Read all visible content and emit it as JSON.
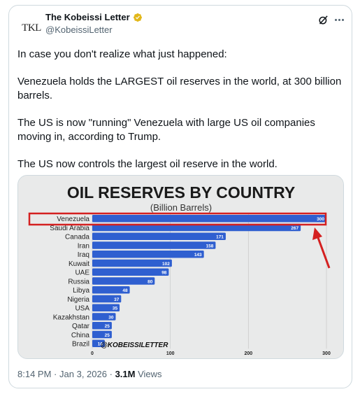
{
  "author": {
    "name": "The Kobeissi Letter",
    "handle": "@KobeissiLetter",
    "avatar_text": "TKL"
  },
  "tweet": {
    "paragraphs": [
      "In case you don't realize what just happened:",
      "Venezuela holds the LARGEST oil reserves in the world, at 300 billion barrels.",
      "The US is now \"running\" Venezuela with large US oil companies moving in, according to Trump.",
      "The US now controls the largest oil reserve in the world."
    ]
  },
  "meta": {
    "time": "8:14 PM",
    "date": "Jan 3, 2026",
    "views_count": "3.1M",
    "views_label": "Views",
    "separator": "·"
  },
  "icons": {
    "verified": "verified-badge-icon",
    "grok": "grok-icon",
    "more": "more-icon"
  },
  "colors": {
    "verified": "#e2b719",
    "bar": "#2f5fd0",
    "highlight": "#d42020",
    "chart_bg": "#e9eaea"
  },
  "chart_data": {
    "type": "bar",
    "orientation": "horizontal",
    "title": "OIL RESERVES BY COUNTRY",
    "subtitle": "(Billion Barrels)",
    "watermark": "@KOBEISSILETTER",
    "categories": [
      "Venezuela",
      "Saudi Arabia",
      "Canada",
      "Iran",
      "Iraq",
      "Kuwait",
      "UAE",
      "Russia",
      "Libya",
      "Nigeria",
      "USA",
      "Kazakhstan",
      "Qatar",
      "China",
      "Brazil"
    ],
    "values": [
      300,
      267,
      171,
      158,
      143,
      102,
      98,
      80,
      48,
      37,
      35,
      30,
      25,
      25,
      16
    ],
    "xlim": [
      0,
      300
    ],
    "xticks": [
      0,
      100,
      200,
      300
    ],
    "grid": true,
    "highlighted_category": "Venezuela"
  }
}
